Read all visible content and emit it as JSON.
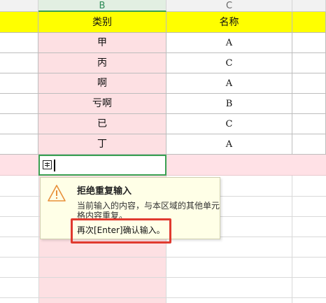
{
  "columns": {
    "b": "B",
    "c": "C"
  },
  "headers": {
    "category": "类别",
    "name": "名称"
  },
  "rows": [
    {
      "category": "甲",
      "name": "A"
    },
    {
      "category": "丙",
      "name": "C"
    },
    {
      "category": "啊",
      "name": "A"
    },
    {
      "category": "亏啊",
      "name": "B"
    },
    {
      "category": "已",
      "name": "C"
    },
    {
      "category": "丁",
      "name": "A"
    }
  ],
  "tooltip": {
    "title": "拒绝重复输入",
    "body": "当前输入的内容，与本区域的其他单元格内容重复。",
    "confirm": "再次[Enter]确认输入。"
  },
  "colors": {
    "header_fill": "#ffff00",
    "column_b_fill": "#fde0e3",
    "selection_border": "#3aa052",
    "highlight_border": "#e03a2f"
  }
}
